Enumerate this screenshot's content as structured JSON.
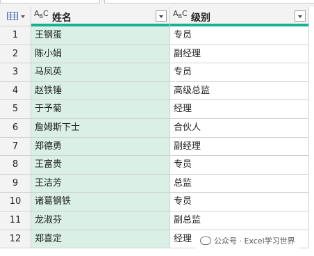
{
  "columns": {
    "name": {
      "label": "姓名",
      "type_icon": "text-type-icon"
    },
    "level": {
      "label": "级别",
      "type_icon": "text-type-icon"
    }
  },
  "type_icon_text": {
    "a": "A",
    "bc": "B",
    "c": "C"
  },
  "rows": [
    {
      "idx": "1",
      "name": "王钢蛋",
      "level": "专员"
    },
    {
      "idx": "2",
      "name": "陈小娟",
      "level": "副经理"
    },
    {
      "idx": "3",
      "name": "马凤英",
      "level": "专员"
    },
    {
      "idx": "4",
      "name": "赵铁锤",
      "level": "高级总监"
    },
    {
      "idx": "5",
      "name": "于予菊",
      "level": "经理"
    },
    {
      "idx": "6",
      "name": "詹姆斯下士",
      "level": "合伙人"
    },
    {
      "idx": "7",
      "name": "郑德勇",
      "level": "副经理"
    },
    {
      "idx": "8",
      "name": "王富贵",
      "level": "专员"
    },
    {
      "idx": "9",
      "name": "王洁芳",
      "level": "总监"
    },
    {
      "idx": "10",
      "name": "诸葛钢铁",
      "level": "专员"
    },
    {
      "idx": "11",
      "name": "龙淑芬",
      "level": "副总监"
    },
    {
      "idx": "12",
      "name": "郑喜定",
      "level": "经理"
    }
  ],
  "watermark": "公众号 · Excel学习世界",
  "colors": {
    "accent": "#17b294",
    "selected_column": "#daf0e6"
  }
}
